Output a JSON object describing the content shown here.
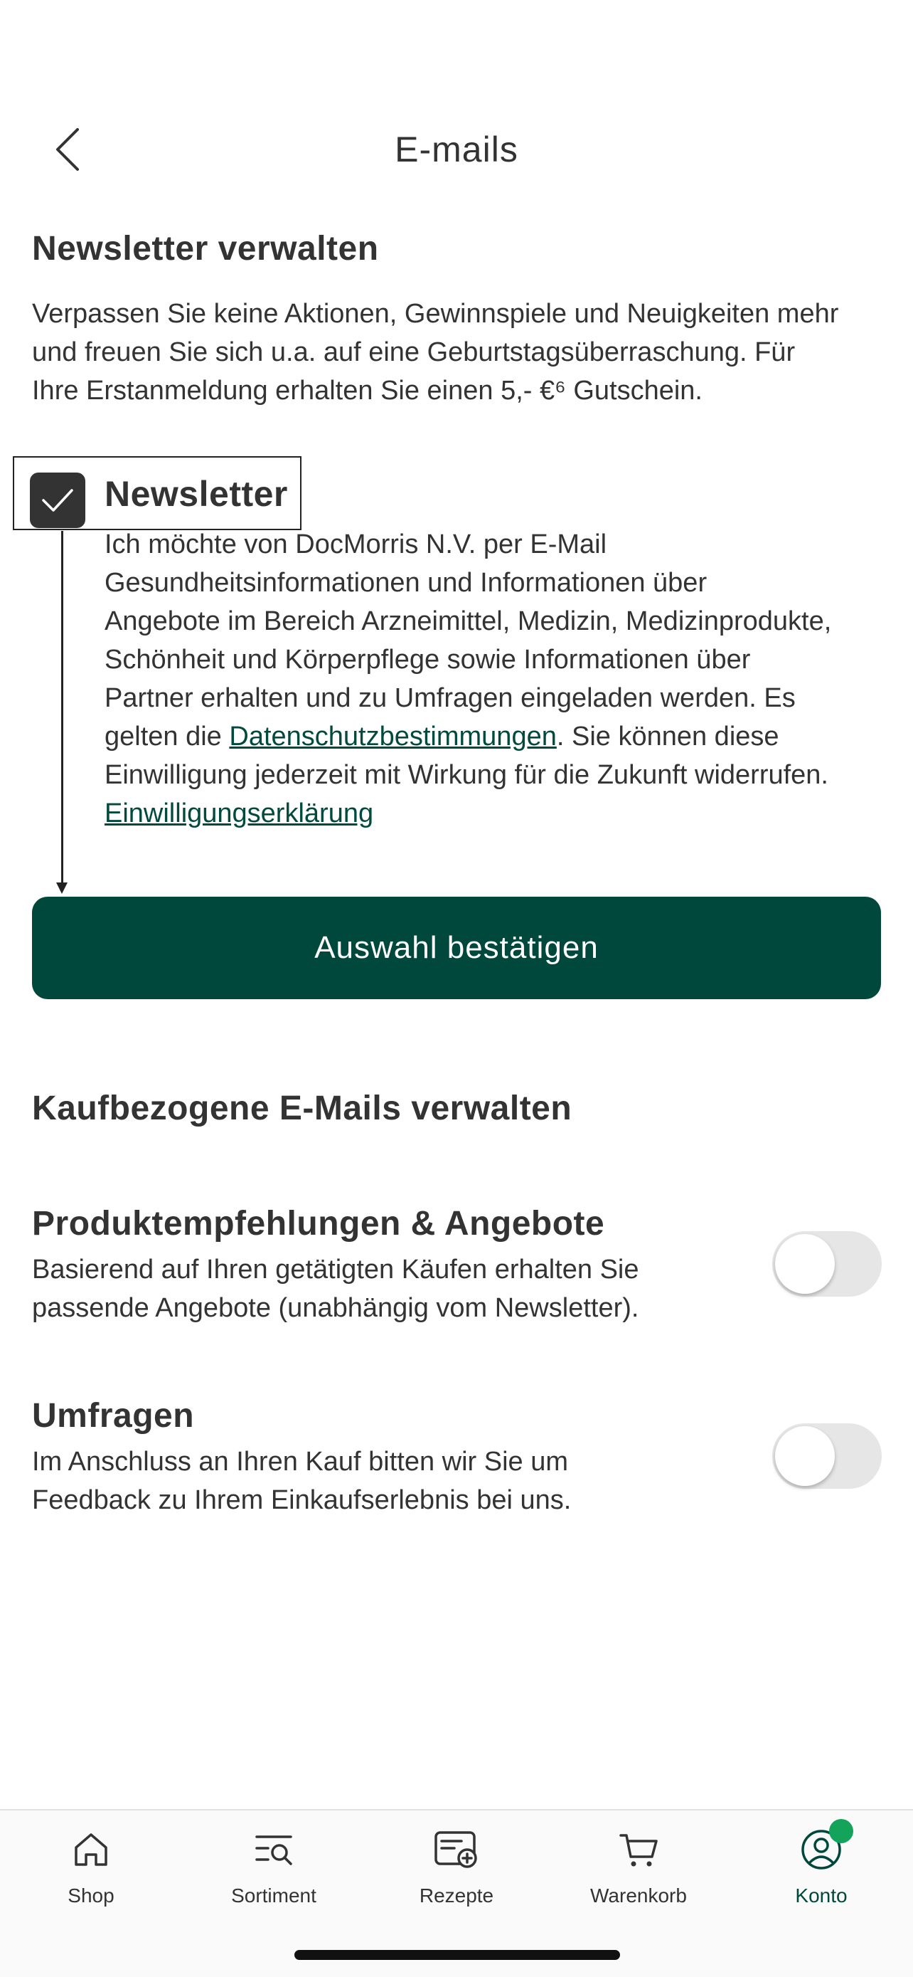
{
  "header": {
    "title": "E-mails"
  },
  "newsletter_section": {
    "title": "Newsletter verwalten",
    "intro_lines": [
      "Verpassen Sie keine Aktionen, Gewinnspiele und Neuigkeiten mehr",
      "und freuen Sie sich u.a. auf eine Geburtstagsüberraschung. Für",
      "Ihre Erstanmeldung erhalten Sie einen 5,- €⁶ Gutschein."
    ],
    "newsletter_checkbox": {
      "label": "Newsletter",
      "checked": true
    },
    "consent_lines": [
      "Ich möchte von DocMorris N.V. per E-Mail",
      "Gesundheitsinformationen und Informationen über",
      "Angebote im Bereich Arzneimittel, Medizin, Medizinprodukte,",
      "Schönheit und Körperpflege sowie Informationen über",
      "Partner erhalten und zu Umfragen eingeladen werden. Es"
    ],
    "consent_line6_prefix": "gelten die ",
    "privacy_link": "Datenschutzbestimmungen",
    "consent_line6_suffix": ". Sie können diese",
    "consent_line7": "Einwilligung jederzeit mit Wirkung für die Zukunft widerrufen.",
    "consent_link": "Einwilligungserklärung",
    "confirm_button": "Auswahl bestätigen"
  },
  "purchase_section": {
    "title": "Kaufbezogene E-Mails verwalten",
    "items": [
      {
        "title": "Produktempfehlungen & Angebote",
        "desc_line1": "Basierend auf Ihren getätigten Käufen erhalten Sie",
        "desc_line2": "passende Angebote (unabhängig vom Newsletter).",
        "enabled": false
      },
      {
        "title": "Umfragen",
        "desc_line1": "Im Anschluss an Ihren Kauf bitten wir Sie um",
        "desc_line2": "Feedback zu Ihrem Einkaufserlebnis bei uns.",
        "enabled": false
      }
    ]
  },
  "bottom_nav": {
    "items": [
      {
        "label": "Shop",
        "icon": "home-icon"
      },
      {
        "label": "Sortiment",
        "icon": "catalog-search-icon"
      },
      {
        "label": "Rezepte",
        "icon": "prescription-add-icon"
      },
      {
        "label": "Warenkorb",
        "icon": "cart-icon"
      },
      {
        "label": "Konto",
        "icon": "account-icon",
        "active": true
      }
    ]
  },
  "colors": {
    "brand": "#00473c",
    "text": "#333333",
    "badge": "#13a35a",
    "toggle_off": "#e6e6e6"
  }
}
